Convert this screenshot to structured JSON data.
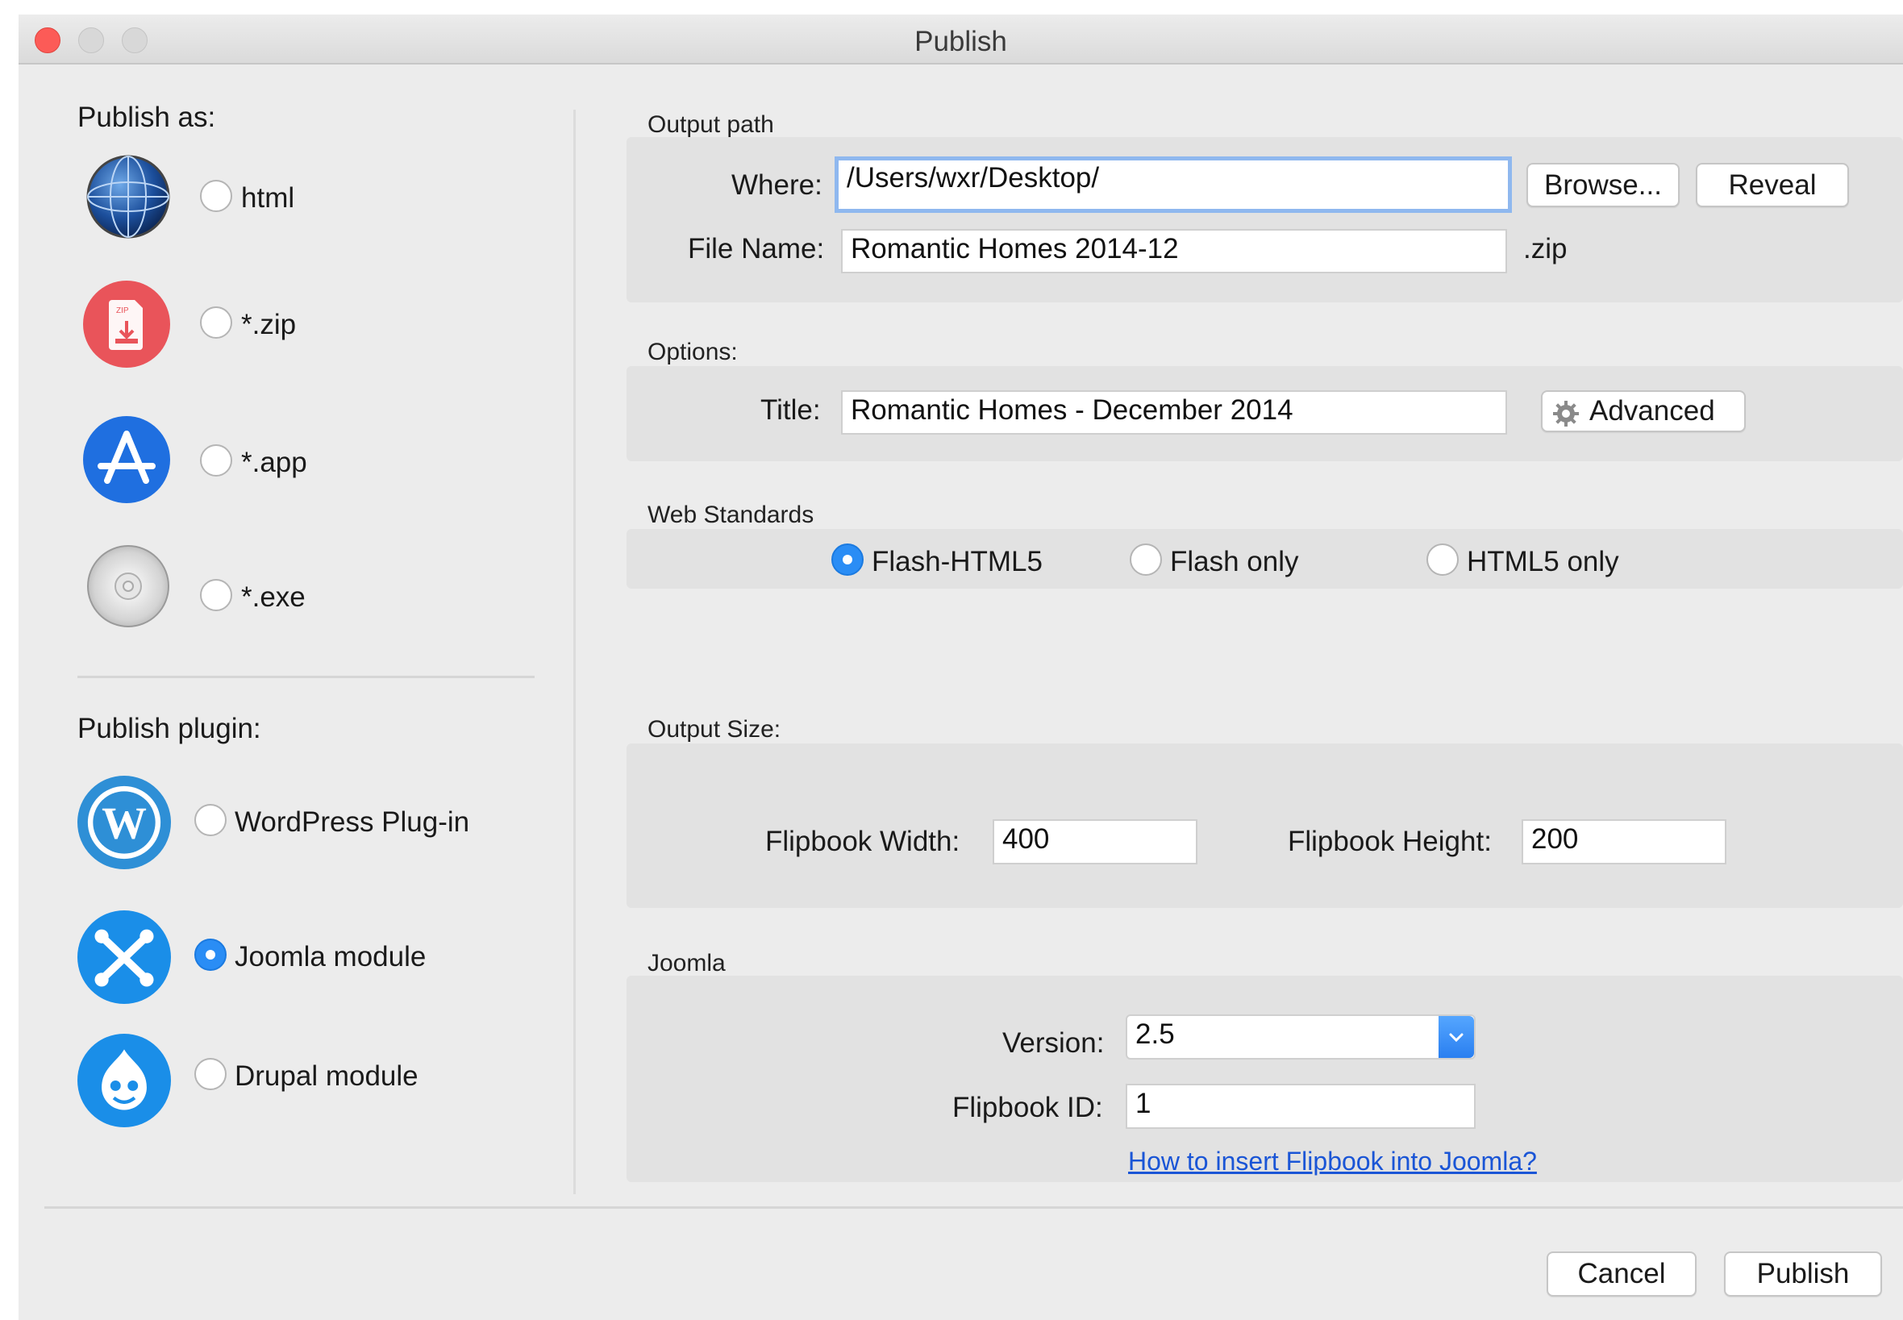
{
  "window": {
    "title": "Publish"
  },
  "publish_as": {
    "label": "Publish as:",
    "options": [
      {
        "label": "html",
        "icon": "globe-icon",
        "selected": false
      },
      {
        "label": "*.zip",
        "icon": "zip-file-icon",
        "selected": false
      },
      {
        "label": "*.app",
        "icon": "app-store-icon",
        "selected": false
      },
      {
        "label": "*.exe",
        "icon": "cd-disc-icon",
        "selected": false
      }
    ]
  },
  "publish_plugin": {
    "label": "Publish plugin:",
    "options": [
      {
        "label": "WordPress Plug-in",
        "icon": "wordpress-icon",
        "selected": false
      },
      {
        "label": "Joomla module",
        "icon": "joomla-icon",
        "selected": true
      },
      {
        "label": "Drupal module",
        "icon": "drupal-icon",
        "selected": false
      }
    ]
  },
  "output_path": {
    "label": "Output path",
    "where_label": "Where:",
    "where_value": "/Users/wxr/Desktop/",
    "browse_button": "Browse...",
    "reveal_button": "Reveal",
    "filename_label": "File Name:",
    "filename_value": "Romantic Homes 2014-12",
    "extension": ".zip"
  },
  "options": {
    "label": "Options:",
    "title_label": "Title:",
    "title_value": "Romantic Homes - December 2014",
    "advanced_button": "Advanced"
  },
  "web_standards": {
    "label": "Web Standards",
    "options": [
      {
        "label": "Flash-HTML5",
        "selected": true
      },
      {
        "label": "Flash only",
        "selected": false
      },
      {
        "label": "HTML5 only",
        "selected": false
      }
    ]
  },
  "output_size": {
    "label": "Output Size:",
    "width_label": "Flipbook Width:",
    "width_value": "400",
    "height_label": "Flipbook Height:",
    "height_value": "200"
  },
  "joomla": {
    "label": "Joomla",
    "version_label": "Version:",
    "version_value": "2.5",
    "id_label": "Flipbook ID:",
    "id_value": "1",
    "help_link": "How to insert Flipbook into Joomla?"
  },
  "footer": {
    "cancel_button": "Cancel",
    "publish_button": "Publish"
  },
  "colors": {
    "accent": "#2a8df5",
    "window_bg": "#ececec",
    "panel_bg": "#e2e2e2",
    "link": "#1a55d6",
    "close_light": "#fc5b57"
  }
}
